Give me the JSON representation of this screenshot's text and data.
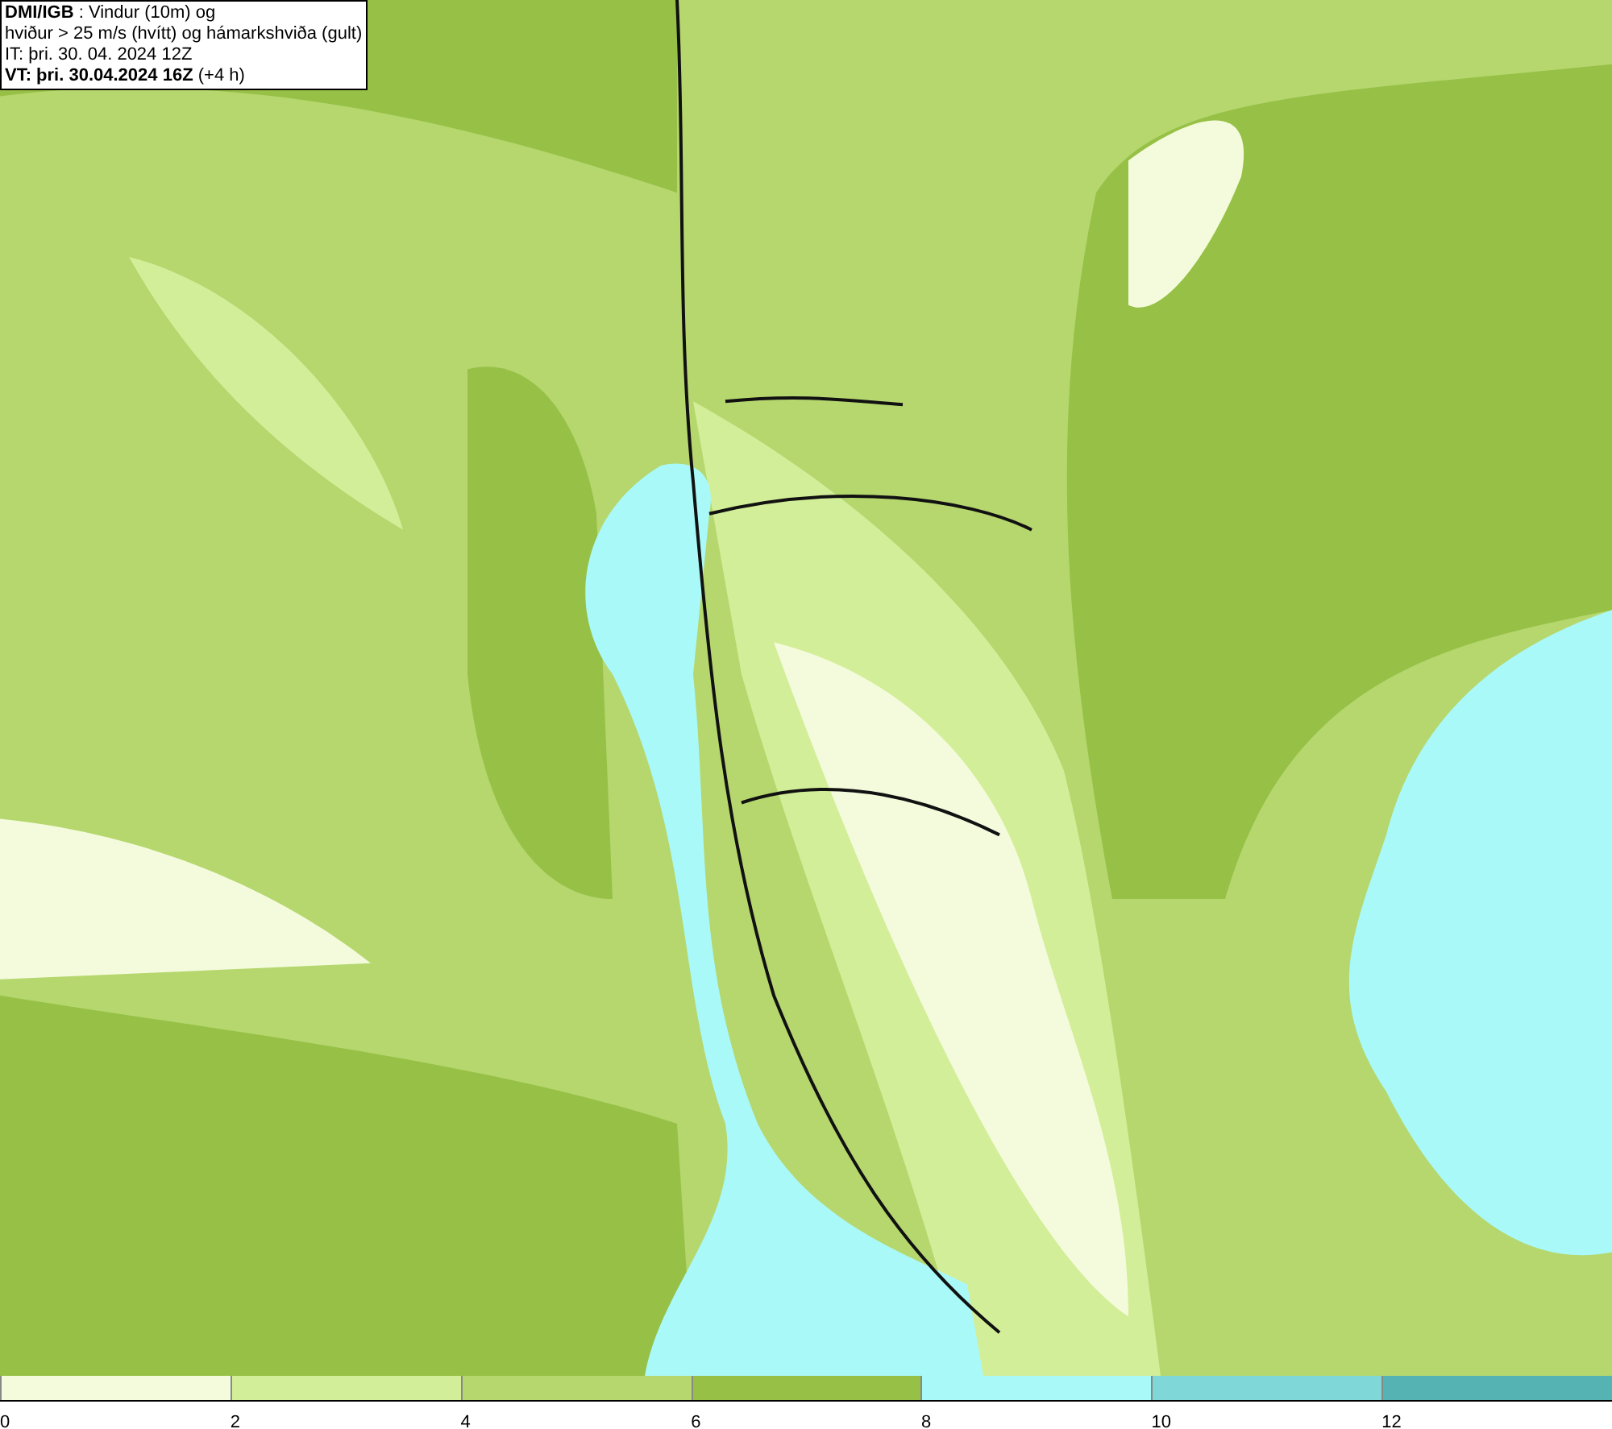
{
  "title_box": {
    "lines": [
      "**DMI/IGB** : Vindur (10m) og",
      "hviður > 25 m/s (hvítt) og hámarkshviða (gult)",
      "IT: þri. 30. 04. 2024 12Z",
      "**VT: þri. 30.04.2024 16Z** (+4 h)"
    ]
  },
  "legend": {
    "segments": [
      {
        "color": "#f4fbdc"
      },
      {
        "color": "#d3ee98"
      },
      {
        "color": "#b5d76e"
      },
      {
        "color": "#97c046"
      },
      {
        "color": "#aaf9f9"
      },
      {
        "color": "#7fd7d7"
      },
      {
        "color": "#56b3b3"
      }
    ],
    "labels": [
      "0",
      "2",
      "4",
      "6",
      "8",
      "10",
      "12"
    ]
  }
}
